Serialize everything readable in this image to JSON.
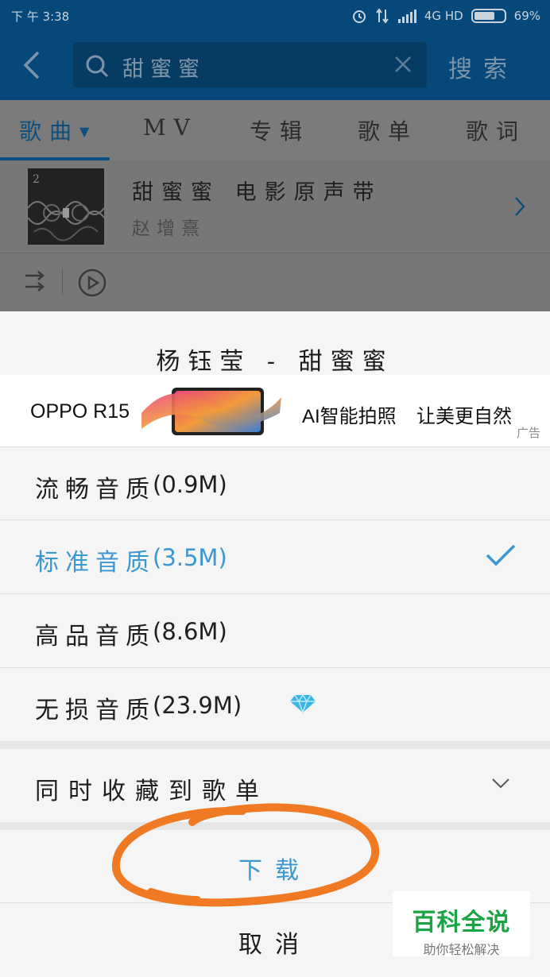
{
  "status_bar": {
    "time": "下 午 3:38",
    "network": "4G HD",
    "battery": "69%",
    "battery_level": 0.69
  },
  "search": {
    "query": "甜蜜蜜",
    "button_label": "搜索"
  },
  "tabs": [
    {
      "label": "歌曲",
      "active": true
    },
    {
      "label": "MV"
    },
    {
      "label": "专辑"
    },
    {
      "label": "歌单"
    },
    {
      "label": "歌词"
    }
  ],
  "album": {
    "title": "甜蜜蜜 电影原声带",
    "artist": "赵增熹"
  },
  "sheet": {
    "title": "杨钰莹 - 甜蜜蜜",
    "ad": {
      "brand": "OPPO R15",
      "slogan_part1": "AI智能拍照",
      "slogan_part2": "让美更自然",
      "tag": "广告"
    },
    "qualities": [
      {
        "label": "流畅音质",
        "size": "(0.9M)",
        "selected": false
      },
      {
        "label": "标准音质",
        "size": "(3.5M)",
        "selected": true
      },
      {
        "label": "高品音质",
        "size": "(8.6M)",
        "selected": false
      },
      {
        "label": "无损音质",
        "size": "(23.9M)",
        "selected": false,
        "vip": true
      }
    ],
    "add_to_playlist": "同时收藏到歌单",
    "download": "下载",
    "cancel": "取消"
  },
  "watermark": {
    "main": "百科全说",
    "sub": "助你轻松解决"
  },
  "colors": {
    "header_blue": "#054879",
    "accent_blue": "#3b97d0",
    "scribble_orange": "#f07a24",
    "watermark_green": "#1aa542"
  }
}
